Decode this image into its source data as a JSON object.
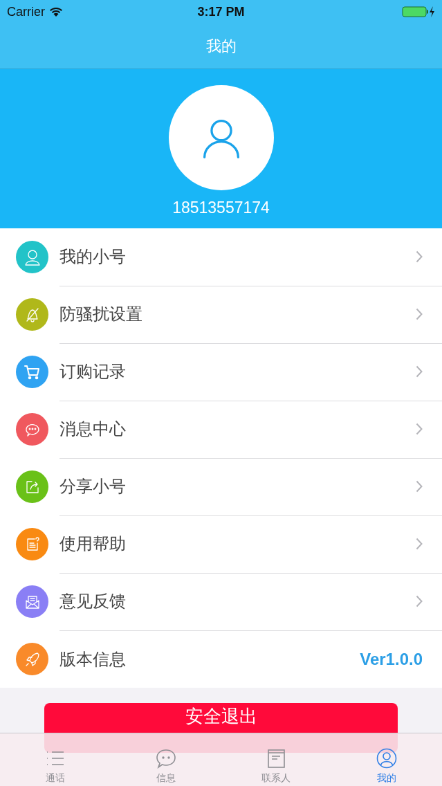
{
  "status_bar": {
    "carrier": "Carrier",
    "time": "3:17 PM"
  },
  "nav": {
    "title": "我的"
  },
  "profile": {
    "phone": "18513557174"
  },
  "menu": [
    {
      "label": "我的小号",
      "color": "#22c3c8"
    },
    {
      "label": "防骚扰设置",
      "color": "#b0b81a"
    },
    {
      "label": "订购记录",
      "color": "#2fa3f2"
    },
    {
      "label": "消息中心",
      "color": "#f0585e"
    },
    {
      "label": "分享小号",
      "color": "#6ac118"
    },
    {
      "label": "使用帮助",
      "color": "#f98a12"
    },
    {
      "label": "意见反馈",
      "color": "#8a7ff5"
    },
    {
      "label": "版本信息",
      "color": "#f98a2a",
      "value": "Ver1.0.0"
    }
  ],
  "logout_button": "安全退出",
  "tabs": [
    {
      "label": "通话",
      "selected": false
    },
    {
      "label": "信息",
      "selected": false
    },
    {
      "label": "联系人",
      "selected": false
    },
    {
      "label": "我的",
      "selected": true
    }
  ]
}
